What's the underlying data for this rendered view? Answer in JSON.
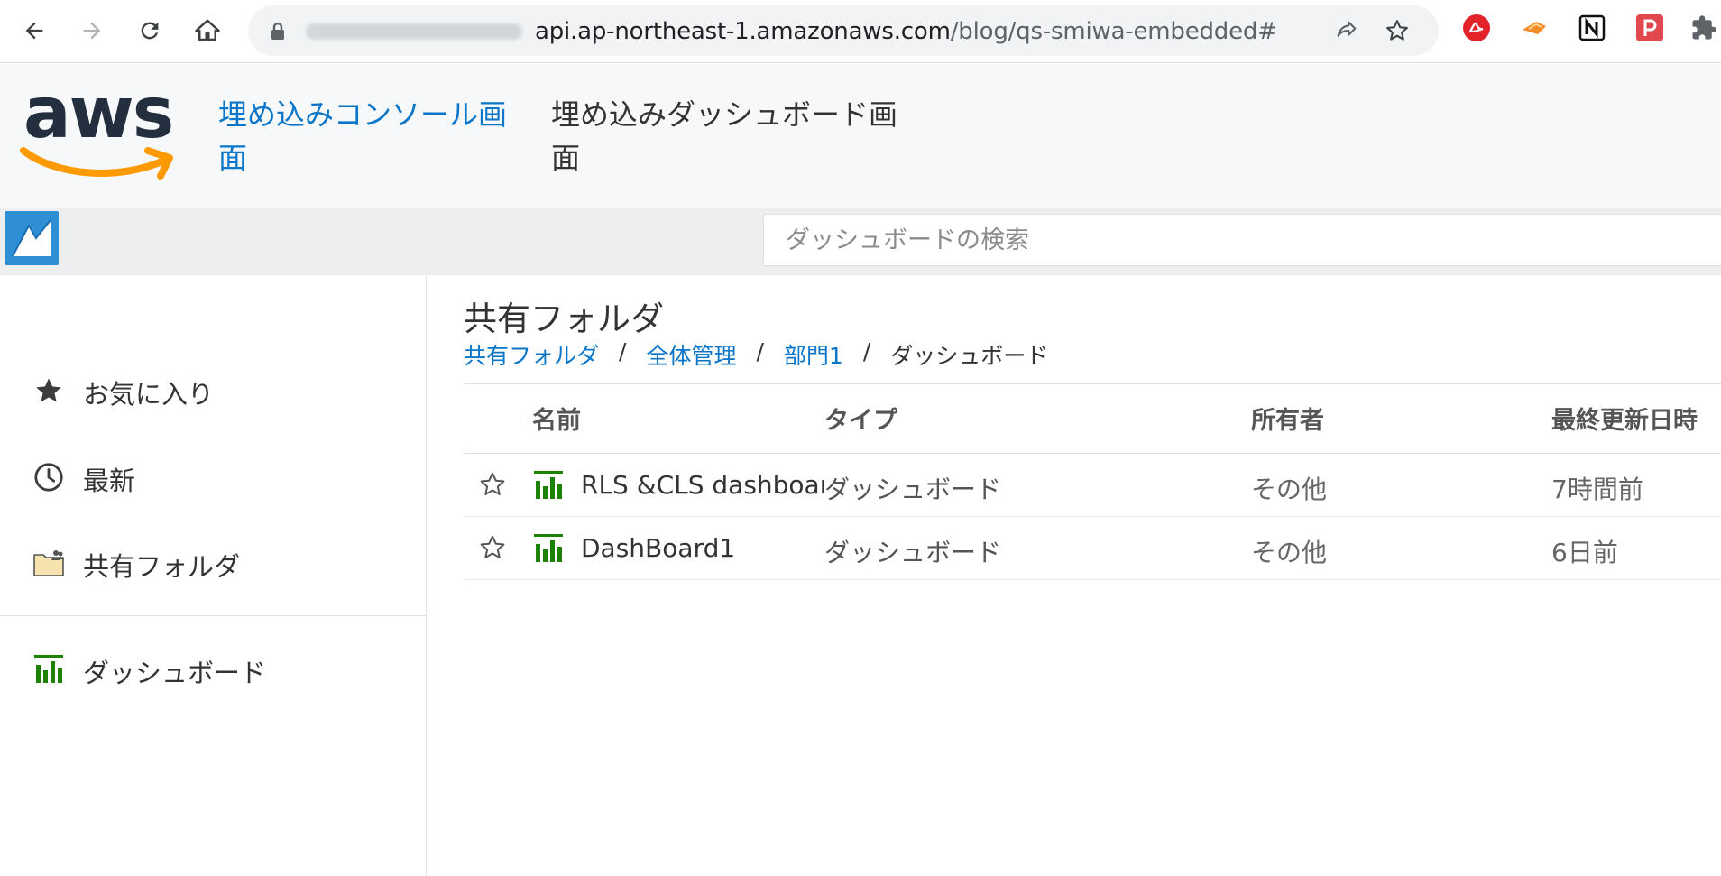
{
  "browser": {
    "url_visible": "api.ap-northeast-1.amazonaws.com",
    "url_path": "/blog/qs-smiwa-embedded#"
  },
  "header": {
    "logo_text": "aws",
    "nav_links": [
      {
        "label": "埋め込みコンソール画面",
        "active": true
      },
      {
        "label": "埋め込みダッシュボード画面",
        "active": false
      }
    ]
  },
  "search": {
    "placeholder": "ダッシュボードの検索"
  },
  "sidebar": {
    "items": [
      {
        "label": "お気に入り",
        "icon": "star-icon"
      },
      {
        "label": "最新",
        "icon": "clock-icon"
      },
      {
        "label": "共有フォルダ",
        "icon": "shared-folder-icon"
      },
      {
        "label": "ダッシュボード",
        "icon": "dashboard-icon"
      }
    ]
  },
  "main": {
    "title": "共有フォルダ",
    "breadcrumb": [
      {
        "label": "共有フォルダ",
        "link": true
      },
      {
        "label": "全体管理",
        "link": true
      },
      {
        "label": "部門1",
        "link": true
      },
      {
        "label": "ダッシュボード",
        "link": false
      }
    ],
    "breadcrumb_separator": "/",
    "table": {
      "headers": [
        "名前",
        "タイプ",
        "所有者",
        "最終更新日時"
      ],
      "rows": [
        {
          "name": "RLS &CLS dashboard",
          "type": "ダッシュボード",
          "owner": "その他",
          "updated": "7時間前"
        },
        {
          "name": "DashBoard1",
          "type": "ダッシュボード",
          "owner": "その他",
          "updated": "6日前"
        }
      ]
    }
  },
  "colors": {
    "link_blue": "#0a76c9",
    "dashboard_green": "#1d8102",
    "aws_orange": "#ff9900",
    "aws_navy": "#232f3e"
  }
}
